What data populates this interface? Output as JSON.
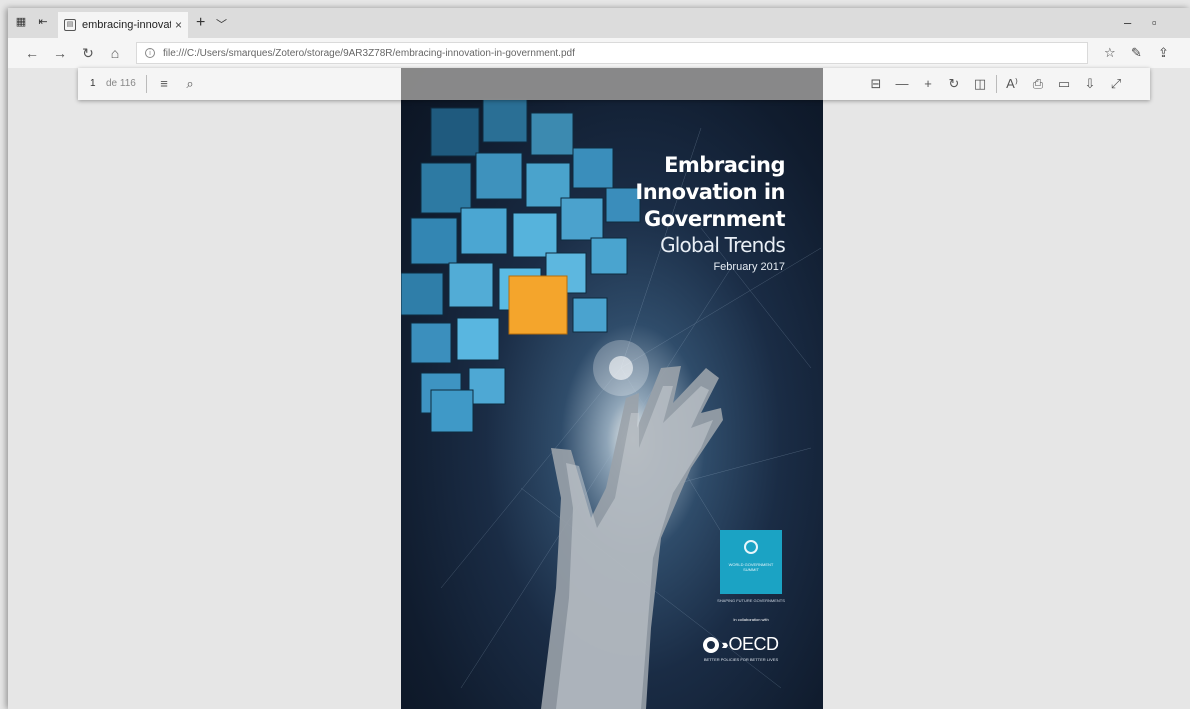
{
  "tab": {
    "title": "embracing-innovation-i",
    "close_glyph": "×"
  },
  "address": {
    "url": "file:///C:/Users/smarques/Zotero/storage/9AR3Z78R/embracing-innovation-in-government.pdf"
  },
  "pdf_toolbar": {
    "page_current": "1",
    "page_total": "de 116"
  },
  "cover": {
    "title_line1": "Embracing",
    "title_line2": "Innovation in",
    "title_line3": "Government",
    "subtitle": "Global Trends",
    "date": "February 2017",
    "wgs_label": "WORLD GOVERNMENT SUMMIT",
    "wgs_tagline": "SHAPING FUTURE GOVERNMENTS",
    "collab": "In collaboration with",
    "oecd_name": "OECD",
    "oecd_tagline": "BETTER POLICIES FOR BETTER LIVES"
  },
  "icons": {
    "tab_actions": "tab-actions-icon",
    "set_aside": "set-aside-tabs-icon",
    "favicon": "pdf-file-icon",
    "new_tab": "plus-icon",
    "tab_menu": "chevron-down-icon",
    "minimize": "minimize-icon",
    "maximize": "restore-icon",
    "back": "arrow-left-icon",
    "forward": "arrow-right-icon",
    "refresh": "refresh-icon",
    "home": "home-icon",
    "info": "info-icon",
    "favorites": "favorites-star-icon",
    "notes": "pen-icon",
    "share": "share-icon",
    "toc": "list-icon",
    "search": "search-icon",
    "fit_width": "fit-to-width-icon",
    "zoom_out": "minus-icon",
    "zoom_in": "plus-icon",
    "rotate": "rotate-icon",
    "page_view": "page-view-icon",
    "read_aloud": "read-aloud-icon",
    "print": "print-icon",
    "save": "save-icon",
    "save_as": "save-as-icon",
    "fullscreen": "fullscreen-icon"
  }
}
